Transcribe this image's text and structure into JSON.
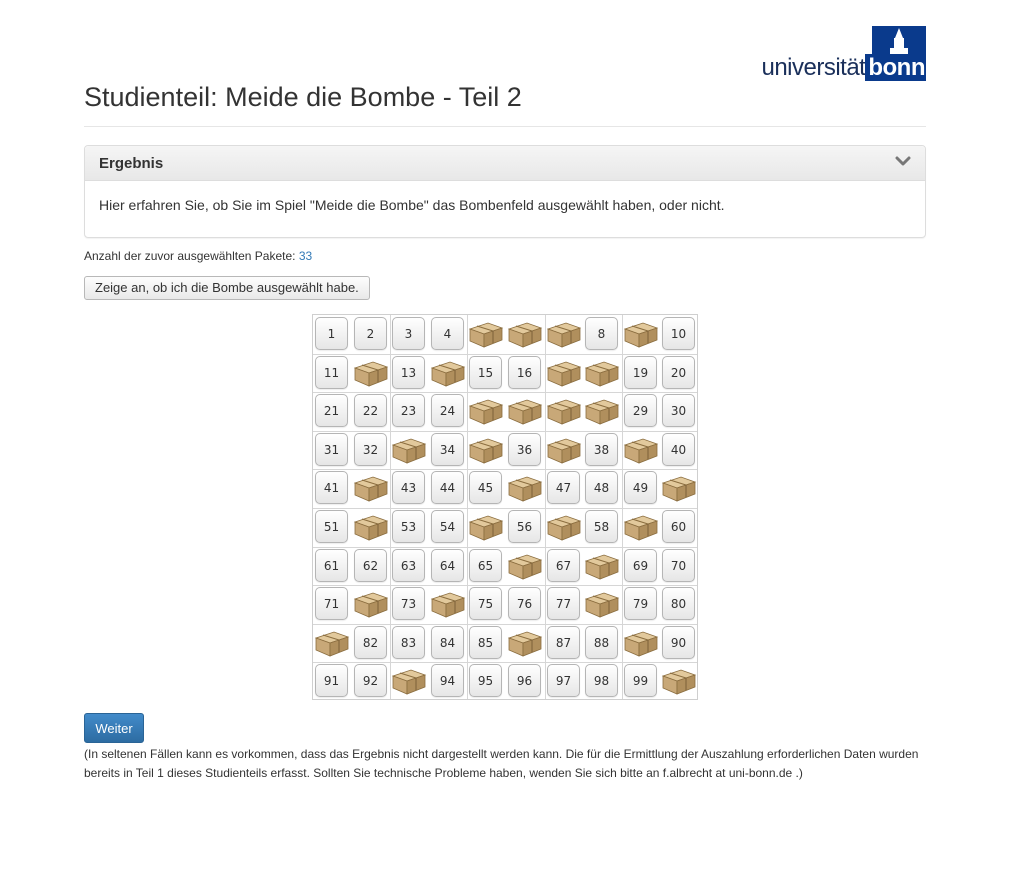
{
  "logo": {
    "part1": "universität",
    "part2": "bonn"
  },
  "page_title": "Studienteil: Meide die Bombe - Teil 2",
  "panel": {
    "title": "Ergebnis",
    "body": "Hier erfahren Sie, ob Sie im Spiel \"Meide die Bombe\" das Bombenfeld ausgewählt haben, oder nicht."
  },
  "selected_count": {
    "label": "Anzahl der zuvor ausgewählten Pakete:",
    "value": "33"
  },
  "show_button_label": "Zeige an, ob ich die Bombe ausgewählt habe.",
  "grid": {
    "rows": [
      [
        "1",
        "2",
        "3",
        "4",
        "box",
        "box",
        "box",
        "8",
        "box",
        "10"
      ],
      [
        "11",
        "box",
        "13",
        "box",
        "15",
        "16",
        "box",
        "box",
        "19",
        "20"
      ],
      [
        "21",
        "22",
        "23",
        "24",
        "box",
        "box",
        "box",
        "box",
        "29",
        "30"
      ],
      [
        "31",
        "32",
        "box",
        "34",
        "box",
        "36",
        "box",
        "38",
        "box",
        "40"
      ],
      [
        "41",
        "box",
        "43",
        "44",
        "45",
        "box",
        "47",
        "48",
        "49",
        "box"
      ],
      [
        "51",
        "box",
        "53",
        "54",
        "box",
        "56",
        "box",
        "58",
        "box",
        "60"
      ],
      [
        "61",
        "62",
        "63",
        "64",
        "65",
        "box",
        "67",
        "box",
        "69",
        "70"
      ],
      [
        "71",
        "box",
        "73",
        "box",
        "75",
        "76",
        "77",
        "box",
        "79",
        "80"
      ],
      [
        "box",
        "82",
        "83",
        "84",
        "85",
        "box",
        "87",
        "88",
        "box",
        "90"
      ],
      [
        "91",
        "92",
        "box",
        "94",
        "95",
        "96",
        "97",
        "98",
        "99",
        "box"
      ]
    ]
  },
  "continue_button_label": "Weiter",
  "note": "(In seltenen Fällen kann es vorkommen, dass das Ergebnis nicht dargestellt werden kann. Die für die Ermittlung der Auszahlung erforderlichen Daten wurden bereits in Teil 1 dieses Studienteils erfasst. Sollten Sie technische Probleme haben, wenden Sie sich bitte an f.albrecht at uni-bonn.de .)",
  "colors": {
    "accent": "#337ab7",
    "brand": "#0a3a8c",
    "package": "#c8a878"
  }
}
